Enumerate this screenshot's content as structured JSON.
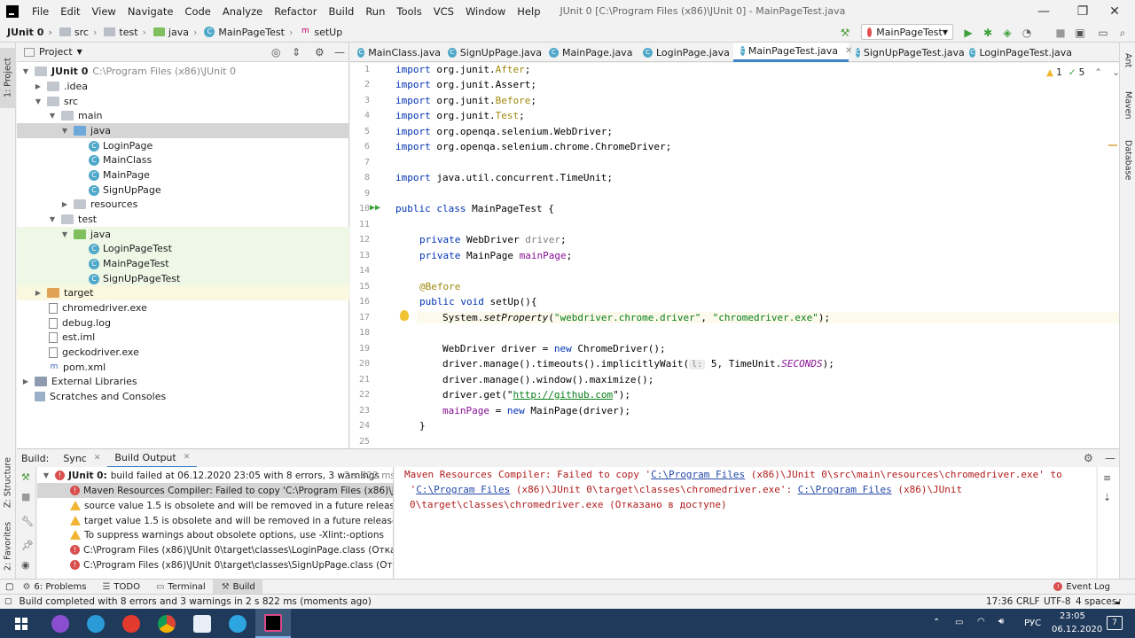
{
  "menubar": {
    "items": [
      "File",
      "Edit",
      "View",
      "Navigate",
      "Code",
      "Analyze",
      "Refactor",
      "Build",
      "Run",
      "Tools",
      "VCS",
      "Window",
      "Help"
    ],
    "window_title": "JUnit 0 [C:\\Program Files (x86)\\JUnit 0] - MainPageTest.java",
    "minimize": "—",
    "maximize": "❐",
    "close": "✕"
  },
  "navbar": {
    "crumbs": [
      "JUnit 0",
      "src",
      "test",
      "java",
      "MainPageTest",
      "setUp"
    ],
    "run_config": "MainPageTest"
  },
  "stripes": {
    "project": "1: Project",
    "structure": "Z: Structure",
    "favorites": "2: Favorites",
    "ant": "Ant",
    "maven": "Maven",
    "database": "Database"
  },
  "project": {
    "header": "Project",
    "tree": [
      {
        "label": "JUnit 0",
        "hint": "C:\\Program Files (x86)\\JUnit 0"
      },
      {
        "label": ".idea"
      },
      {
        "label": "src"
      },
      {
        "label": "main"
      },
      {
        "label": "java"
      },
      {
        "label": "LoginPage"
      },
      {
        "label": "MainClass"
      },
      {
        "label": "MainPage"
      },
      {
        "label": "SignUpPage"
      },
      {
        "label": "resources"
      },
      {
        "label": "test"
      },
      {
        "label": "java"
      },
      {
        "label": "LoginPageTest"
      },
      {
        "label": "MainPageTest"
      },
      {
        "label": "SignUpPageTest"
      },
      {
        "label": "target"
      },
      {
        "label": "chromedriver.exe"
      },
      {
        "label": "debug.log"
      },
      {
        "label": "est.iml"
      },
      {
        "label": "geckodriver.exe"
      },
      {
        "label": "pom.xml"
      },
      {
        "label": "External Libraries"
      },
      {
        "label": "Scratches and Consoles"
      }
    ]
  },
  "editor": {
    "tabs": [
      "MainClass.java",
      "SignUpPage.java",
      "MainPage.java",
      "LoginPage.java",
      "MainPageTest.java",
      "SignUpPageTest.java",
      "LoginPageTest.java"
    ],
    "warnings": "1",
    "oks": "5",
    "line_numbers": [
      "1",
      "2",
      "3",
      "4",
      "5",
      "6",
      "7",
      "8",
      "9",
      "10",
      "11",
      "12",
      "13",
      "14",
      "15",
      "16",
      "17",
      "18",
      "19",
      "20",
      "21",
      "22",
      "23",
      "24",
      "25"
    ],
    "code": {
      "l1_kw": "import",
      "l1": " org.junit.",
      "l1_b": "After",
      "l1_e": ";",
      "l2_kw": "import",
      "l2": " org.junit.Assert;",
      "l3_kw": "import",
      "l3": " org.junit.",
      "l3_b": "Before",
      "l3_e": ";",
      "l4_kw": "import",
      "l4": " org.junit.",
      "l4_b": "Test",
      "l4_e": ";",
      "l5_kw": "import",
      "l5": " org.openqa.selenium.WebDriver;",
      "l6_kw": "import",
      "l6": " org.openqa.selenium.chrome.ChromeDriver;",
      "l8_kw": "import",
      "l8": " java.util.concurrent.TimeUnit;",
      "l10_kw": "public class",
      "l10": " MainPageTest {",
      "l12_kw": "private",
      "l12": " WebDriver ",
      "l12_f": "driver",
      "l12_e": ";",
      "l13_kw": "private",
      "l13": " MainPage ",
      "l13_f": "mainPage",
      "l13_e": ";",
      "l15_ann": "@Before",
      "l16_kw": "public void",
      "l16": " setUp(){",
      "l17_a": "System.",
      "l17_m": "setProperty",
      "l17_b": "(",
      "l17_s1": "\"webdriver.chrome.driver\"",
      "l17_c": ", ",
      "l17_s2": "\"chromedriver.exe\"",
      "l17_e": ");",
      "l19_a": "WebDriver driver = ",
      "l19_kw": "new",
      "l19_b": " ChromeDriver();",
      "l20_a": "driver.manage().timeouts().implicitlyWait(",
      "l20_hint": "l:",
      "l20_b": " 5, TimeUnit.",
      "l20_c": "SECONDS",
      "l20_e": ");",
      "l21": "driver.manage().window().maximize();",
      "l22_a": "driver.get(\"",
      "l22_url": "http://github.com",
      "l22_e": "\");",
      "l23_f": "mainPage",
      "l23_a": " = ",
      "l23_kw": "new",
      "l23_b": " MainPage(driver);",
      "l24": "}"
    }
  },
  "build": {
    "label": "Build:",
    "tabs": [
      "Sync",
      "Build Output"
    ],
    "summary_title": "JUnit 0:",
    "summary": "build failed at 06.12.2020 23:05 with 8 errors, 3 warnings",
    "summary_time": "2 s 822 ms",
    "rows": [
      "Maven Resources Compiler: Failed to copy 'C:\\Program Files (x86)\\JUnit 0\\src\\",
      "source value 1.5 is obsolete and will be removed in a future release",
      "target value 1.5 is obsolete and will be removed in a future release",
      "To suppress warnings about obsolete options, use -Xlint:-options",
      "C:\\Program Files (x86)\\JUnit 0\\target\\classes\\LoginPage.class (Отказано в до",
      "C:\\Program Files (x86)\\JUnit 0\\target\\classes\\SignUpPage.class (Отказано в д"
    ],
    "output": {
      "l1_a": "Maven Resources Compiler: Failed to copy '",
      "l1_link": "C:\\Program Files",
      "l1_b": " (x86)\\JUnit 0\\src\\main\\resources\\chromedriver.exe' to",
      "l2_a": " '",
      "l2_link": "C:\\Program Files",
      "l2_b": " (x86)\\JUnit 0\\target\\classes\\chromedriver.exe': ",
      "l2_link2": "C:\\Program Files",
      "l2_c": " (x86)\\JUnit",
      "l3": "0\\target\\classes\\chromedriver.exe (Отказано в доступе)"
    }
  },
  "tool_tabs": {
    "problems": "6: Problems",
    "todo": "TODO",
    "terminal": "Terminal",
    "build": "Build",
    "event_log": "Event Log"
  },
  "status": {
    "message": "Build completed with 8 errors and 3 warnings in 2 s 822 ms (moments ago)",
    "position": "17:36",
    "line_sep": "CRLF",
    "encoding": "UTF-8",
    "indent": "4 spaces"
  },
  "taskbar": {
    "lang": "РУС",
    "time": "23:05",
    "date": "06.12.2020",
    "notif": "7"
  },
  "colors": {
    "accent": "#4083c9",
    "error": "#d94f4f",
    "warning": "#f0b432",
    "keyword": "#0033b3",
    "string": "#067d17"
  }
}
